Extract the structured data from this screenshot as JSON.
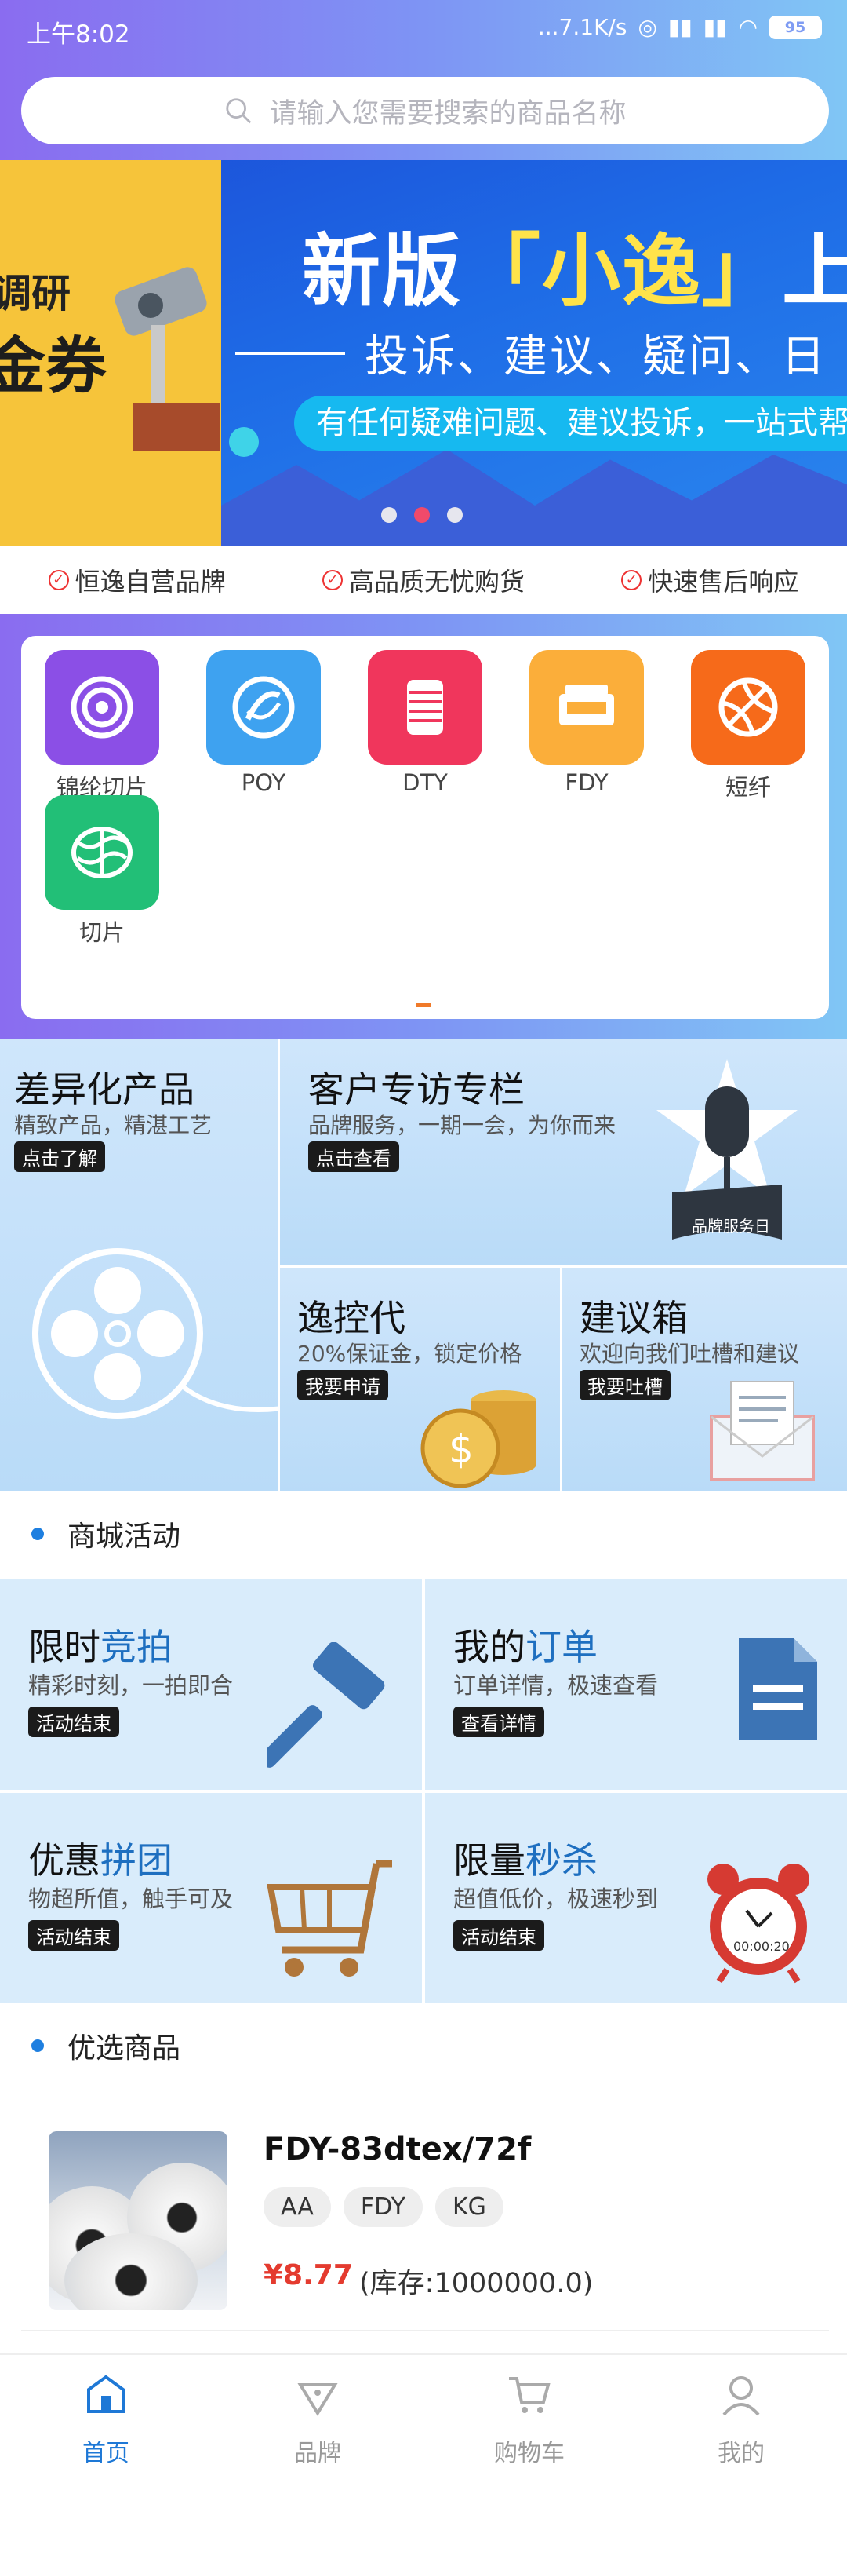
{
  "status": {
    "time": "上午8:02",
    "net": "...7.1K/s",
    "battery": "95"
  },
  "search": {
    "placeholder": "请输入您需要搜索的商品名称"
  },
  "banner": {
    "left_line1": "调研",
    "left_line2": "金券",
    "title_a": "新版",
    "title_hl": "「小逸」",
    "title_b": "上线",
    "subtitle": "投诉、建议、疑问、日",
    "pill": "有任何疑难问题、建议投诉，一站式帮",
    "dots": 3,
    "active_dot": 2
  },
  "features": [
    "恒逸自营品牌",
    "高品质无忧购货",
    "快速售后响应"
  ],
  "categories": [
    {
      "label": "锦纶切片",
      "color": "#8b4fe6",
      "icon": "spiral-icon"
    },
    {
      "label": "POY",
      "color": "#3ea2f0",
      "icon": "swirl-icon"
    },
    {
      "label": "DTY",
      "color": "#f0365c",
      "icon": "spool-icon"
    },
    {
      "label": "FDY",
      "color": "#fbae3a",
      "icon": "machine-icon"
    },
    {
      "label": "短纤",
      "color": "#f66a1a",
      "icon": "ball-icon"
    },
    {
      "label": "切片",
      "color": "#22bf77",
      "icon": "net-icon"
    }
  ],
  "promos": {
    "diff": {
      "title": "差异化产品",
      "sub": "精致产品，精湛工艺",
      "tag": "点击了解"
    },
    "visit": {
      "title": "客户专访专栏",
      "sub": "品牌服务，一期一会，为你而来",
      "tag": "点击查看",
      "badge": "品牌服务日"
    },
    "control": {
      "title": "逸控代",
      "sub": "20%保证金，锁定价格",
      "tag": "我要申请"
    },
    "advice": {
      "title": "建议箱",
      "sub": "欢迎向我们吐槽和建议",
      "tag": "我要吐槽"
    }
  },
  "sections": {
    "mall": "商城活动",
    "goods": "优选商品"
  },
  "activities": [
    {
      "title_a": "限时",
      "title_b": "竞拍",
      "sub": "精彩时刻，一拍即合",
      "tag": "活动结束",
      "icon": "gavel-icon"
    },
    {
      "title_a": "我的",
      "title_b": "订单",
      "sub": "订单详情，极速查看",
      "tag": "查看详情",
      "icon": "document-icon"
    },
    {
      "title_a": "优惠",
      "title_b": "拼团",
      "sub": "物超所值，触手可及",
      "tag": "活动结束",
      "icon": "cart-icon"
    },
    {
      "title_a": "限量",
      "title_b": "秒杀",
      "sub": "超值低价，极速秒到",
      "tag": "活动结束",
      "icon": "alarm-clock-icon",
      "clock": "00:00:20"
    }
  ],
  "product": {
    "name": "FDY-83dtex/72f",
    "chips": [
      "AA",
      "FDY",
      "KG"
    ],
    "price": "¥8.77",
    "stock": "(库存:1000000.0)"
  },
  "tabs": [
    {
      "label": "首页",
      "icon": "home-icon",
      "active": true
    },
    {
      "label": "品牌",
      "icon": "brand-icon",
      "active": false
    },
    {
      "label": "购物车",
      "icon": "cart-icon",
      "active": false
    },
    {
      "label": "我的",
      "icon": "user-icon",
      "active": false
    }
  ],
  "colors": {
    "accent": "#1e78d6",
    "price": "#e43b2f",
    "banner": "#1e6be6"
  }
}
